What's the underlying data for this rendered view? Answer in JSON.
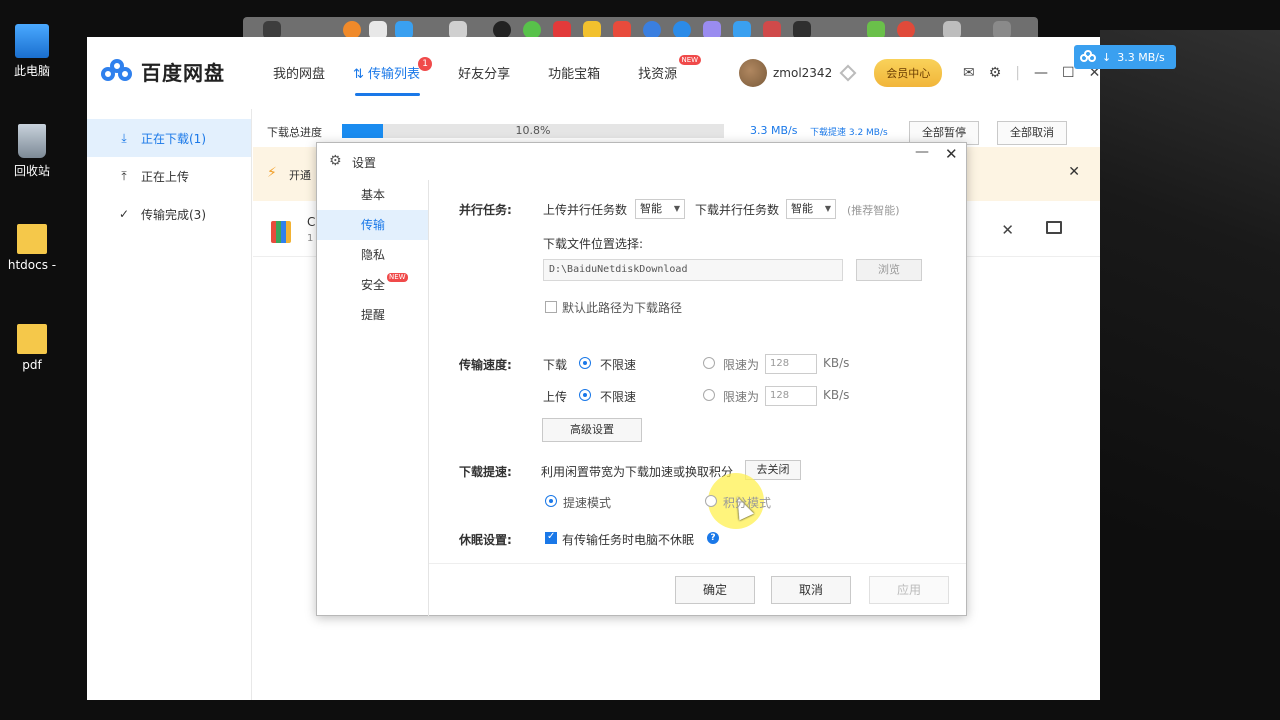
{
  "desktop": {
    "icons": [
      {
        "label": "此电脑"
      },
      {
        "label": "回收站"
      },
      {
        "label": "htdocs -"
      },
      {
        "label": "pdf"
      }
    ]
  },
  "floating_widget": {
    "speed": "3.3 MB/s"
  },
  "app": {
    "logo": "百度网盘",
    "nav": [
      {
        "label": "我的网盘"
      },
      {
        "label": "传输列表",
        "badge": "1"
      },
      {
        "label": "好友分享"
      },
      {
        "label": "功能宝箱"
      },
      {
        "label": "找资源",
        "badge": "NEW"
      }
    ],
    "username": "zmol2342",
    "vip_label": "会员中心",
    "sidebar": [
      {
        "label": "正在下载(1)",
        "icon": "download-icon"
      },
      {
        "label": "正在上传",
        "icon": "upload-icon"
      },
      {
        "label": "传输完成(3)",
        "icon": "check-circle-icon"
      }
    ],
    "progress": {
      "label": "下载总进度",
      "percent_text": "10.8%",
      "fraction": 0.108,
      "speed": "3.3 MB/s",
      "boost": "下载提速 3.2 MB/s",
      "pause_all": "全部暂停",
      "cancel_all": "全部取消"
    },
    "notice": {
      "text": "开通"
    },
    "file": {
      "name": "C",
      "sub": "1"
    }
  },
  "dialog": {
    "title": "设置",
    "tabs": [
      {
        "label": "基本"
      },
      {
        "label": "传输"
      },
      {
        "label": "隐私"
      },
      {
        "label": "安全",
        "badge": "NEW"
      },
      {
        "label": "提醒"
      }
    ],
    "parallel": {
      "label": "并行任务:",
      "upload_label": "上传并行任务数",
      "upload_value": "智能",
      "download_label": "下载并行任务数",
      "download_value": "智能",
      "hint": "(推荐智能)"
    },
    "location": {
      "label": "下载文件位置选择:",
      "path": "D:\\BaiduNetdiskDownload",
      "browse": "浏览",
      "default_label": "默认此路径为下载路径"
    },
    "speed": {
      "label": "传输速度:",
      "download": "下载",
      "upload": "上传",
      "unlimited": "不限速",
      "limit_to": "限速为",
      "dl_value": "128",
      "ul_value": "128",
      "unit": "KB/s",
      "advanced": "高级设置"
    },
    "boost": {
      "label": "下载提速:",
      "desc": "利用闲置带宽为下载加速或换取积分",
      "go_close": "去关闭",
      "mode_speed": "提速模式",
      "mode_points": "积分模式"
    },
    "sleep": {
      "label": "休眠设置:",
      "option": "有传输任务时电脑不休眠"
    },
    "footer": {
      "ok": "确定",
      "cancel": "取消",
      "apply": "应用"
    }
  }
}
